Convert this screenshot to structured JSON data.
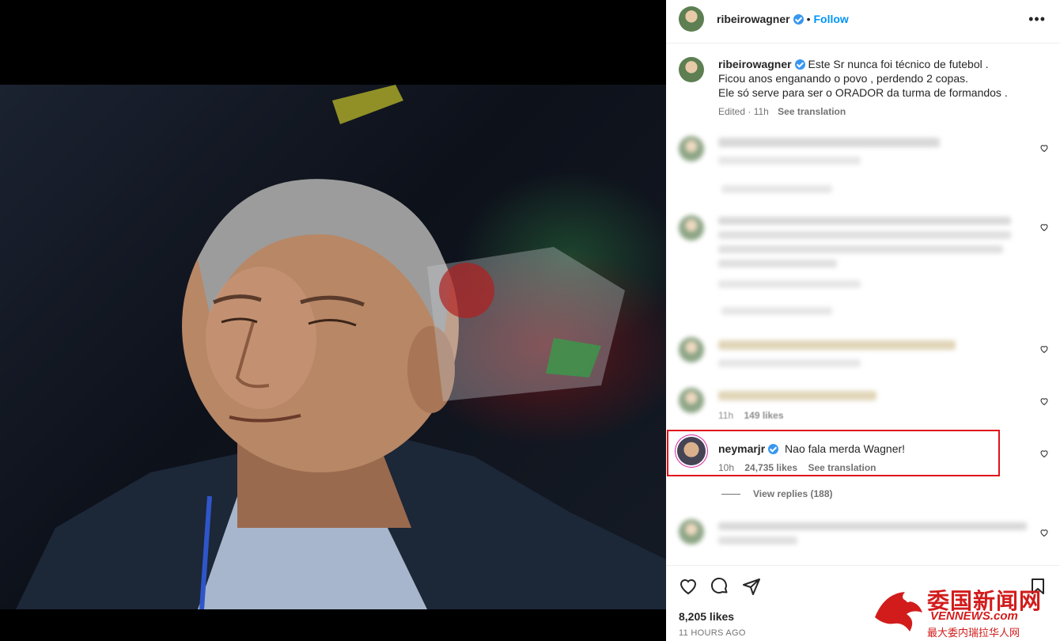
{
  "post": {
    "author": "ribeirowagner",
    "follow_label": "Follow",
    "more_label": "•••",
    "dot": "•"
  },
  "caption": {
    "username": "ribeirowagner",
    "lines": [
      "Este Sr nunca foi técnico de futebol .",
      "Ficou anos enganando o povo , perdendo 2 copas.",
      "Ele só serve para ser o ORADOR da turma de formandos ."
    ],
    "edited": "Edited · 11h",
    "see_translation": "See translation"
  },
  "comments": [
    {
      "username": "neymarjr",
      "text": "Nao fala merda Wagner!",
      "time": "10h",
      "likes": "24,735 likes",
      "see_translation": "See translation",
      "view_replies": "View replies (188)"
    }
  ],
  "blurred_partial_text": "149 likes",
  "blurred_partial_time": "11h",
  "footer": {
    "likes": "8,205 likes",
    "time": "11 HOURS AGO"
  },
  "watermark": {
    "title": "委国新闻网",
    "domain": "VENNEWS.com",
    "subtitle": "最大委内瑞拉华人网"
  },
  "colors": {
    "accent": "#0095f6",
    "highlight": "#e0121a",
    "verified": "#3797f0"
  }
}
